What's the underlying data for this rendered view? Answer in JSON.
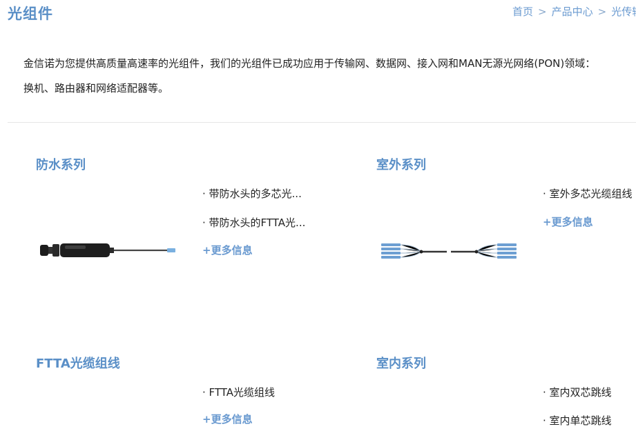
{
  "header": {
    "title": "光组件",
    "breadcrumb": {
      "home": "首页",
      "products": "产品中心",
      "current": "光传输",
      "sep": ">"
    }
  },
  "intro": {
    "line1": "金信诺为您提供高质量高速率的光组件，我们的光组件已成功应用于传输网、数据网、接入网和MAN无源光网络(PON)领域：",
    "line2": "换机、路由器和网络适配器等。"
  },
  "sections": {
    "waterproof": {
      "title": "防水系列",
      "items": [
        "· 带防水头的多芯光...",
        "· 带防水头的FTTA光..."
      ],
      "more": "+更多信息",
      "image_icon": "waterproof-fiber-cable"
    },
    "outdoor": {
      "title": "室外系列",
      "items": [
        "· 室外多芯光缆组线"
      ],
      "more": "+更多信息",
      "image_icon": "breakout-fiber-cable"
    },
    "ftta": {
      "title": "FTTA光缆组线",
      "items": [
        "· FTTA光缆组线"
      ],
      "more": "+更多信息"
    },
    "indoor": {
      "title": "室内系列",
      "items": [
        "· 室内双芯跳线",
        "· 室内单芯跳线"
      ]
    }
  },
  "colors": {
    "accent": "#5a8fc7",
    "link": "#6a9ad0",
    "divider": "#e6e6e6"
  }
}
